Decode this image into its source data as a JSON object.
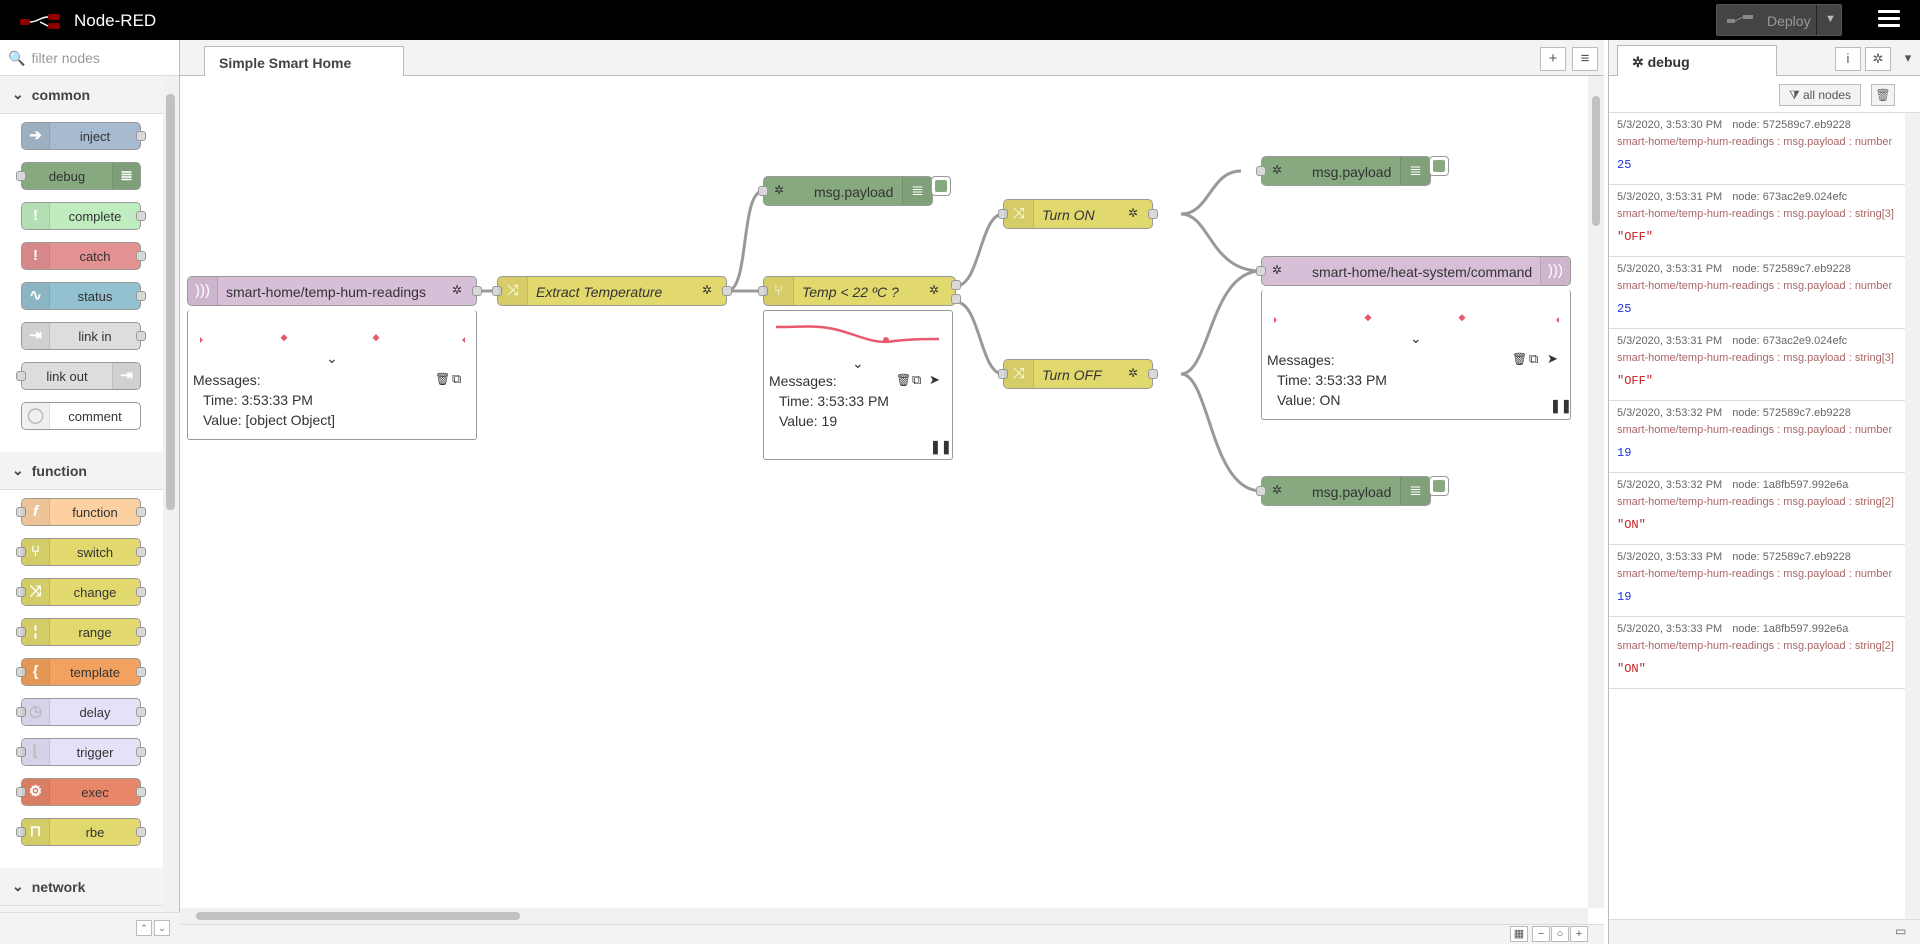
{
  "header": {
    "app_title": "Node-RED",
    "deploy_label": "Deploy"
  },
  "palette": {
    "search_placeholder": "filter nodes",
    "categories": [
      {
        "name": "common",
        "nodes": [
          {
            "label": "inject",
            "color": "#a6bbcf"
          },
          {
            "label": "debug",
            "color": "#87a980"
          },
          {
            "label": "complete",
            "color": "#c0edc0"
          },
          {
            "label": "catch",
            "color": "#e49191"
          },
          {
            "label": "status",
            "color": "#94c1d0"
          },
          {
            "label": "link in",
            "color": "#dddddd"
          },
          {
            "label": "link out",
            "color": "#dddddd"
          },
          {
            "label": "comment",
            "color": "#ffffff"
          }
        ]
      },
      {
        "name": "function",
        "nodes": [
          {
            "label": "function",
            "color": "#fdd0a2"
          },
          {
            "label": "switch",
            "color": "#e2d96e"
          },
          {
            "label": "change",
            "color": "#e2d96e"
          },
          {
            "label": "range",
            "color": "#e2d96e"
          },
          {
            "label": "template",
            "color": "#f2a25e"
          },
          {
            "label": "delay",
            "color": "#e6e0f8"
          },
          {
            "label": "trigger",
            "color": "#e6e0f8"
          },
          {
            "label": "exec",
            "color": "#e8866a"
          },
          {
            "label": "rbe",
            "color": "#e2d96e"
          }
        ]
      },
      {
        "name": "network",
        "nodes": []
      }
    ]
  },
  "workspace": {
    "tab": "Simple Smart Home"
  },
  "flow": {
    "mqtt_in": {
      "label": "smart-home/temp-hum-readings",
      "status": "connected",
      "panel_title": "Messages:",
      "time": "Time: 3:53:33 PM",
      "value": "Value: [object Object]"
    },
    "extract": {
      "label": "Extract Temperature"
    },
    "switch": {
      "label": "Temp < 22 ºC ?",
      "panel_title": "Messages:",
      "time": "Time: 3:53:33 PM",
      "value": "Value: 19"
    },
    "debug_top": {
      "label": "msg.payload"
    },
    "turn_on": {
      "label": "Turn ON"
    },
    "turn_off": {
      "label": "Turn OFF"
    },
    "debug_right_top": {
      "label": "msg.payload"
    },
    "debug_right_bottom": {
      "label": "msg.payload"
    },
    "mqtt_out": {
      "label": "smart-home/heat-system/command",
      "status": "connected",
      "panel_title": "Messages:",
      "time": "Time: 3:53:33 PM",
      "value": "Value: ON"
    }
  },
  "sidebar": {
    "tab": "debug",
    "filter_label": "all nodes",
    "messages": [
      {
        "time": "5/3/2020, 3:53:30 PM",
        "node": "node: 572589c7.eb9228",
        "path": "smart-home/temp-hum-readings : msg.payload : number",
        "value": "25",
        "kind": "num"
      },
      {
        "time": "5/3/2020, 3:53:31 PM",
        "node": "node: 673ac2e9.024efc",
        "path": "smart-home/temp-hum-readings : msg.payload : string[3]",
        "value": "\"OFF\"",
        "kind": "str"
      },
      {
        "time": "5/3/2020, 3:53:31 PM",
        "node": "node: 572589c7.eb9228",
        "path": "smart-home/temp-hum-readings : msg.payload : number",
        "value": "25",
        "kind": "num"
      },
      {
        "time": "5/3/2020, 3:53:31 PM",
        "node": "node: 673ac2e9.024efc",
        "path": "smart-home/temp-hum-readings : msg.payload : string[3]",
        "value": "\"OFF\"",
        "kind": "str"
      },
      {
        "time": "5/3/2020, 3:53:32 PM",
        "node": "node: 572589c7.eb9228",
        "path": "smart-home/temp-hum-readings : msg.payload : number",
        "value": "19",
        "kind": "num"
      },
      {
        "time": "5/3/2020, 3:53:32 PM",
        "node": "node: 1a8fb597.992e6a",
        "path": "smart-home/temp-hum-readings : msg.payload : string[2]",
        "value": "\"ON\"",
        "kind": "str"
      },
      {
        "time": "5/3/2020, 3:53:33 PM",
        "node": "node: 572589c7.eb9228",
        "path": "smart-home/temp-hum-readings : msg.payload : number",
        "value": "19",
        "kind": "num"
      },
      {
        "time": "5/3/2020, 3:53:33 PM",
        "node": "node: 1a8fb597.992e6a",
        "path": "smart-home/temp-hum-readings : msg.payload : string[2]",
        "value": "\"ON\"",
        "kind": "str"
      }
    ]
  },
  "colors": {
    "mqtt": "#d8bfd8",
    "change": "#e2d96e",
    "debug": "#87a980",
    "wire": "#999999",
    "chart": "#e8586f"
  }
}
